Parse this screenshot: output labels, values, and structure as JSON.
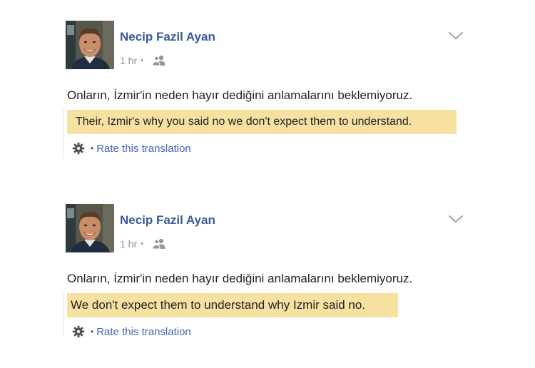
{
  "posts": [
    {
      "author": "Necip Fazil Ayan",
      "time": "1 hr",
      "meta_separator": "•",
      "original_text": "Onların, İzmir'in neden hayır dediğini anlamalarını beklemiyoruz.",
      "translation": "Their, Izmir's why you said no we don't expect them to understand.",
      "rate_separator": "•",
      "rate_link": "Rate this translation",
      "privacy_icon": "friends-icon",
      "menu_icon": "chevron-down-icon",
      "settings_icon": "gear-icon"
    },
    {
      "author": "Necip Fazil Ayan",
      "time": "1 hr",
      "meta_separator": "•",
      "original_text": "Onların, İzmir'in neden hayır dediğini anlamalarını beklemiyoruz.",
      "translation": "We don't expect them to understand why Izmir said no.",
      "rate_separator": "•",
      "rate_link": "Rate this translation",
      "privacy_icon": "friends-icon",
      "menu_icon": "chevron-down-icon",
      "settings_icon": "gear-icon"
    }
  ],
  "colors": {
    "author_link": "#3b5998",
    "meta_gray": "#9197a3",
    "translation_highlight": "#f7e1a0",
    "rate_link": "#4267b2",
    "body_text": "#1d2129"
  }
}
